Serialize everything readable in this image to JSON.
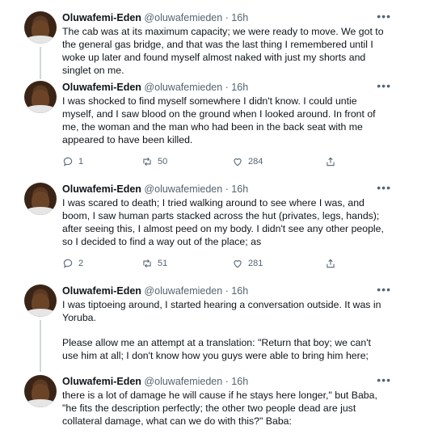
{
  "tweets": [
    {
      "name": "Oluwafemi-Eden",
      "handle": "@oluwafemieden · 16h",
      "text": "The cab was at its maximum capacity; we were ready to move. We got to the general gas bridge, and that was the last thing I remembered until I woke up later and found myself almost naked with just my shorts and singlet on me."
    },
    {
      "name": "Oluwafemi-Eden",
      "handle": "@oluwafemieden · 16h",
      "text": "I was shocked to find myself somewhere I didn't know. I could untie myself, and I saw blood on the ground when I looked around. In front of me, the woman and the man who had been in the back seat with me appeared to have been killed.",
      "replies": "1",
      "retweets": "50",
      "likes": "284"
    },
    {
      "name": "Oluwafemi-Eden",
      "handle": "@oluwafemieden · 16h",
      "text": "I was scared to death; I tried walking around to see where I was, and boom, I saw human parts stacked across the hut (privates, legs, hands); after seeing this, I almost peed on my body. I didn't see any other people, so I decided to find a way out of the place; as",
      "replies": "2",
      "retweets": "51",
      "likes": "281"
    },
    {
      "name": "Oluwafemi-Eden",
      "handle": "@oluwafemieden · 16h",
      "text": "I was tiptoeing around, I started hearing a conversation outside. It was in Yoruba.",
      "text2": "Please allow me an attempt at a translation: \"Return that boy; we can't use him at all; I don't know how you guys were able to bring him here;"
    },
    {
      "name": "Oluwafemi-Eden",
      "handle": "@oluwafemieden · 16h",
      "text": "there is a lot of damage he will cause if he stays here longer,\" but Baba, \"he fits the description perfectly; the other two people dead are just collateral damage, what can we do with this?\" Baba:"
    }
  ],
  "more_icon": "•••",
  "colors": {
    "text": "#0f1419",
    "secondary": "#536471",
    "line": "#cfd9de"
  }
}
